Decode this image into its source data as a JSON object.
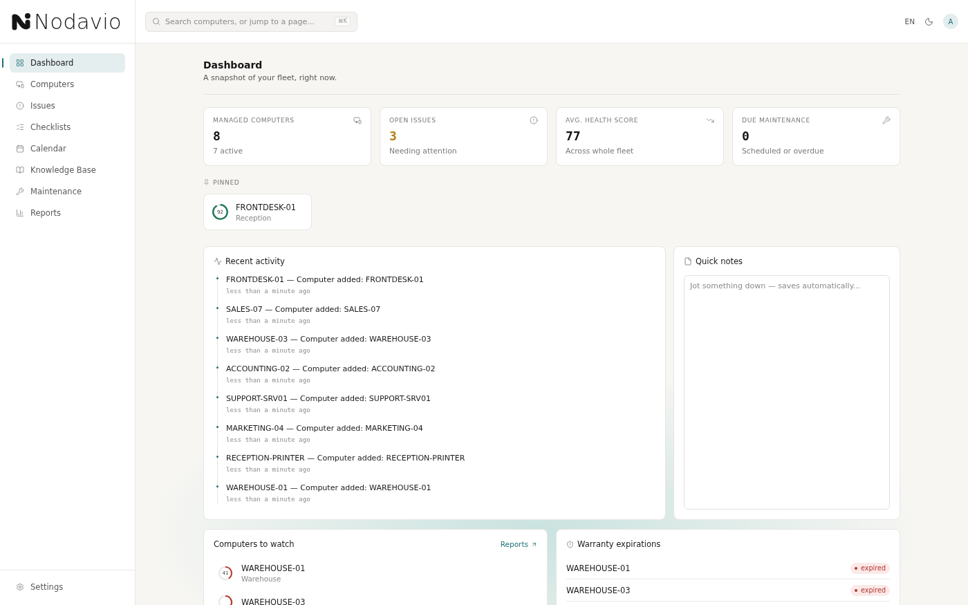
{
  "header": {
    "logo": "Nodavio",
    "search": {
      "placeholder": "Search computers, or jump to a page...",
      "shortcut": "⌘K"
    },
    "language": "EN",
    "avatar": "A"
  },
  "sidebar": {
    "items": [
      {
        "label": "Dashboard",
        "selected": true
      },
      {
        "label": "Computers",
        "selected": false
      },
      {
        "label": "Issues",
        "selected": false
      },
      {
        "label": "Checklists",
        "selected": false
      },
      {
        "label": "Calendar",
        "selected": false
      },
      {
        "label": "Knowledge Base",
        "selected": false
      },
      {
        "label": "Maintenance",
        "selected": false
      },
      {
        "label": "Reports",
        "selected": false
      }
    ],
    "footer": [
      {
        "label": "Settings",
        "selected": false
      }
    ]
  },
  "page": {
    "title": "Dashboard",
    "subtitle": "A snapshot of your fleet, right now."
  },
  "stats": [
    {
      "label": "MANAGED COMPUTERS",
      "value": "8",
      "caption": "7 active",
      "warning": false
    },
    {
      "label": "OPEN ISSUES",
      "value": "3",
      "caption": "Needing attention",
      "warning": true
    },
    {
      "label": "AVG. HEALTH SCORE",
      "value": "77",
      "caption": "Across whole fleet",
      "warning": false
    },
    {
      "label": "DUE MAINTENANCE",
      "value": "0",
      "caption": "Scheduled or overdue",
      "warning": false
    }
  ],
  "pinned": {
    "label": "PINNED",
    "items": [
      {
        "name": "FRONTDESK-01",
        "location": "Reception",
        "score": "92",
        "level": 0.92
      }
    ]
  },
  "recent_activity": {
    "title": "Recent activity",
    "items": [
      {
        "text": "FRONTDESK-01 — Computer added: FRONTDESK-01",
        "time": "less than a minute ago"
      },
      {
        "text": "SALES-07 — Computer added: SALES-07",
        "time": "less than a minute ago"
      },
      {
        "text": "WAREHOUSE-03 — Computer added: WAREHOUSE-03",
        "time": "less than a minute ago"
      },
      {
        "text": "ACCOUNTING-02 — Computer added: ACCOUNTING-02",
        "time": "less than a minute ago"
      },
      {
        "text": "SUPPORT-SRV01 — Computer added: SUPPORT-SRV01",
        "time": "less than a minute ago"
      },
      {
        "text": "MARKETING-04 — Computer added: MARKETING-04",
        "time": "less than a minute ago"
      },
      {
        "text": "RECEPTION-PRINTER — Computer added: RECEPTION-PRINTER",
        "time": "less than a minute ago"
      },
      {
        "text": "WAREHOUSE-01 — Computer added: WAREHOUSE-01",
        "time": "less than a minute ago"
      }
    ]
  },
  "quick_notes": {
    "title": "Quick notes",
    "placeholder": "Jot something down — saves automatically..."
  },
  "computers_to_watch": {
    "title": "Computers to watch",
    "link": "Reports",
    "items": [
      {
        "name": "WAREHOUSE-01",
        "location": "Warehouse",
        "score": "41",
        "level": 0.41
      },
      {
        "name": "WAREHOUSE-03",
        "level": 0.34
      }
    ]
  },
  "warranty_expirations": {
    "title": "Warranty expirations",
    "items": [
      {
        "name": "WAREHOUSE-01",
        "badge": "expired"
      },
      {
        "name": "WAREHOUSE-03",
        "badge": "expired"
      }
    ]
  }
}
